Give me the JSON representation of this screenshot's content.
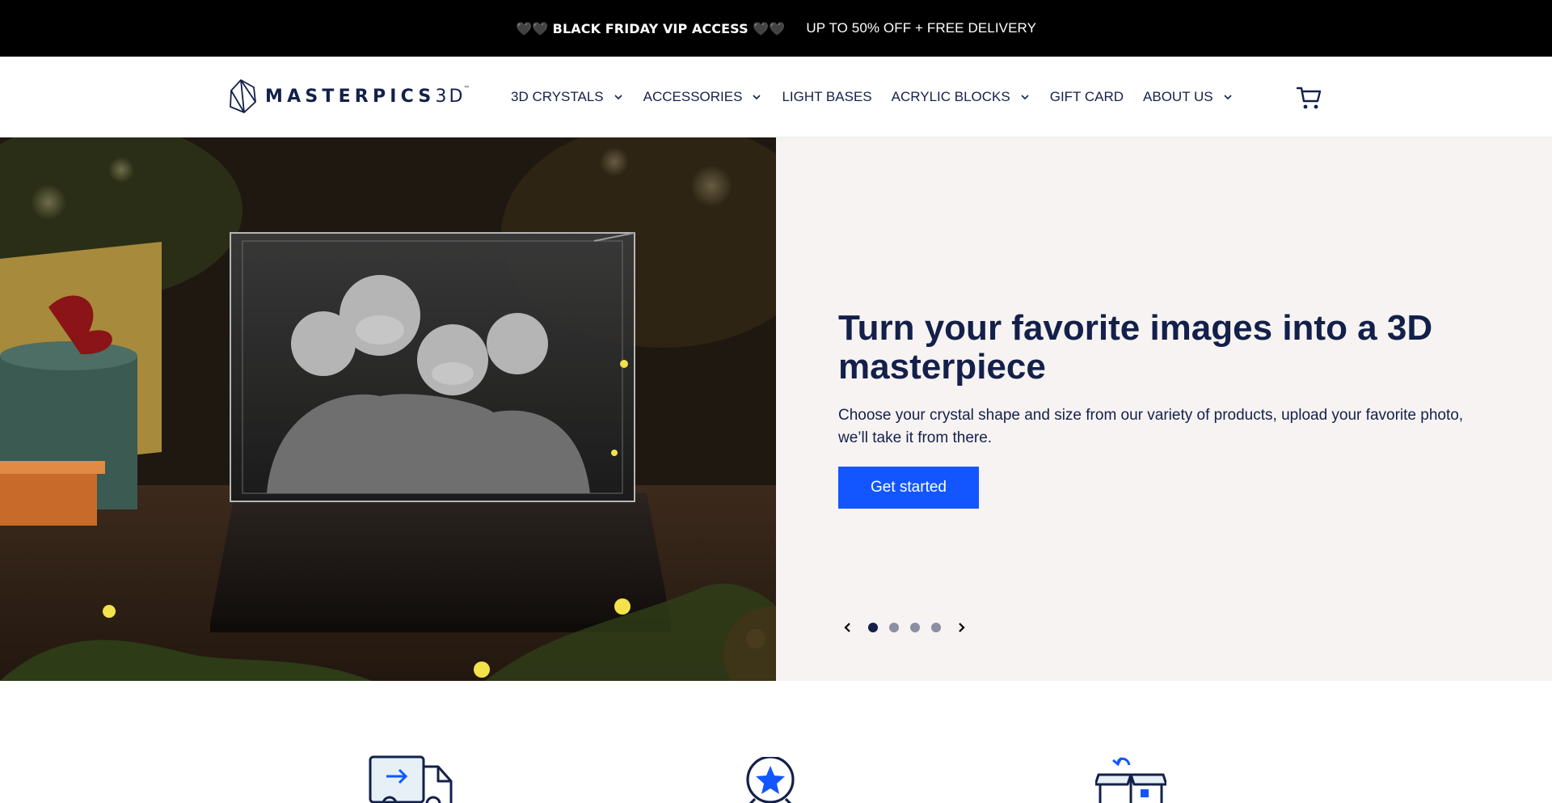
{
  "announcement": {
    "vip": "🖤🖤 BLACK FRIDAY VIP ACCESS 🖤🖤",
    "offer": "UP TO 50% OFF + FREE DELIVERY"
  },
  "header": {
    "logo": {
      "brand": "MASTERPICS",
      "suffix": "3D",
      "tm": "™"
    },
    "nav": [
      {
        "label": "3D CRYSTALS",
        "has_dropdown": true
      },
      {
        "label": "ACCESSORIES",
        "has_dropdown": true
      },
      {
        "label": "LIGHT BASES",
        "has_dropdown": false
      },
      {
        "label": "ACRYLIC BLOCKS",
        "has_dropdown": true
      },
      {
        "label": "GIFT CARD",
        "has_dropdown": false
      },
      {
        "label": "ABOUT US",
        "has_dropdown": true
      }
    ],
    "cart_icon": "cart-icon"
  },
  "hero": {
    "title": "Turn your favorite images into a 3D masterpiece",
    "subtitle": "Choose your crystal shape and size from our variety of products, upload your favorite photo, we’ll take it from there.",
    "cta": "Get started",
    "slides_total": 4,
    "active_slide": 1
  },
  "features": {
    "icons": [
      "delivery-truck-icon",
      "quality-badge-icon",
      "return-box-icon"
    ]
  },
  "colors": {
    "navy": "#13204a",
    "accent_blue": "#1356ff",
    "panel_bg": "#f7f3f2",
    "announce_bg": "#000000"
  }
}
